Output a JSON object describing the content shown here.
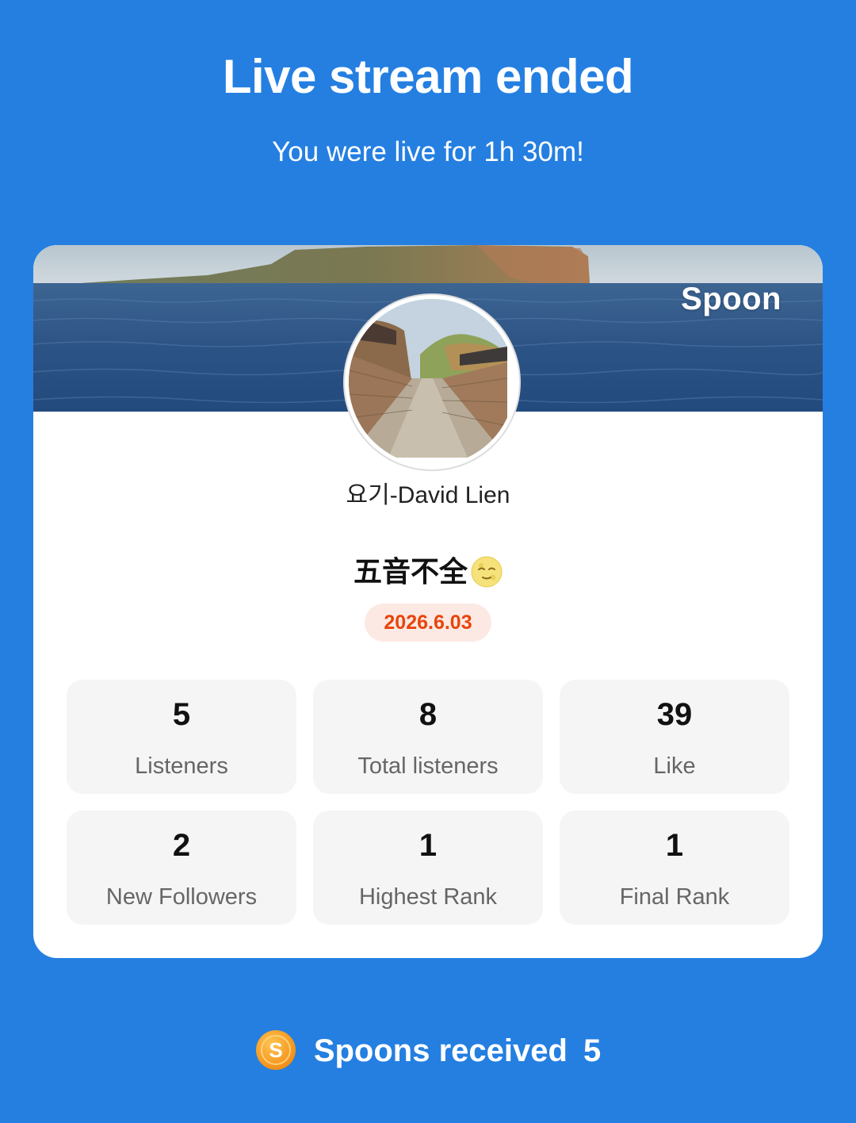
{
  "header": {
    "title": "Live stream ended",
    "subtitle": "You were live for 1h 30m!"
  },
  "card": {
    "brand": "Spoon",
    "username": "요기-David Lien",
    "live_title": "五音不全",
    "title_emoji_icon": "full-moon-face-icon",
    "date": "2026.6.03",
    "stats": [
      {
        "value": "5",
        "label": "Listeners"
      },
      {
        "value": "8",
        "label": "Total listeners"
      },
      {
        "value": "39",
        "label": "Like"
      },
      {
        "value": "2",
        "label": "New Followers"
      },
      {
        "value": "1",
        "label": "Highest Rank"
      },
      {
        "value": "1",
        "label": "Final Rank"
      }
    ]
  },
  "footer": {
    "coin_icon": "spoon-coin-icon",
    "spoons_label": "Spoons received",
    "spoons_count": "5"
  },
  "colors": {
    "background": "#247fe1",
    "date_text": "#e8440b",
    "date_bg": "#fde9e3"
  }
}
